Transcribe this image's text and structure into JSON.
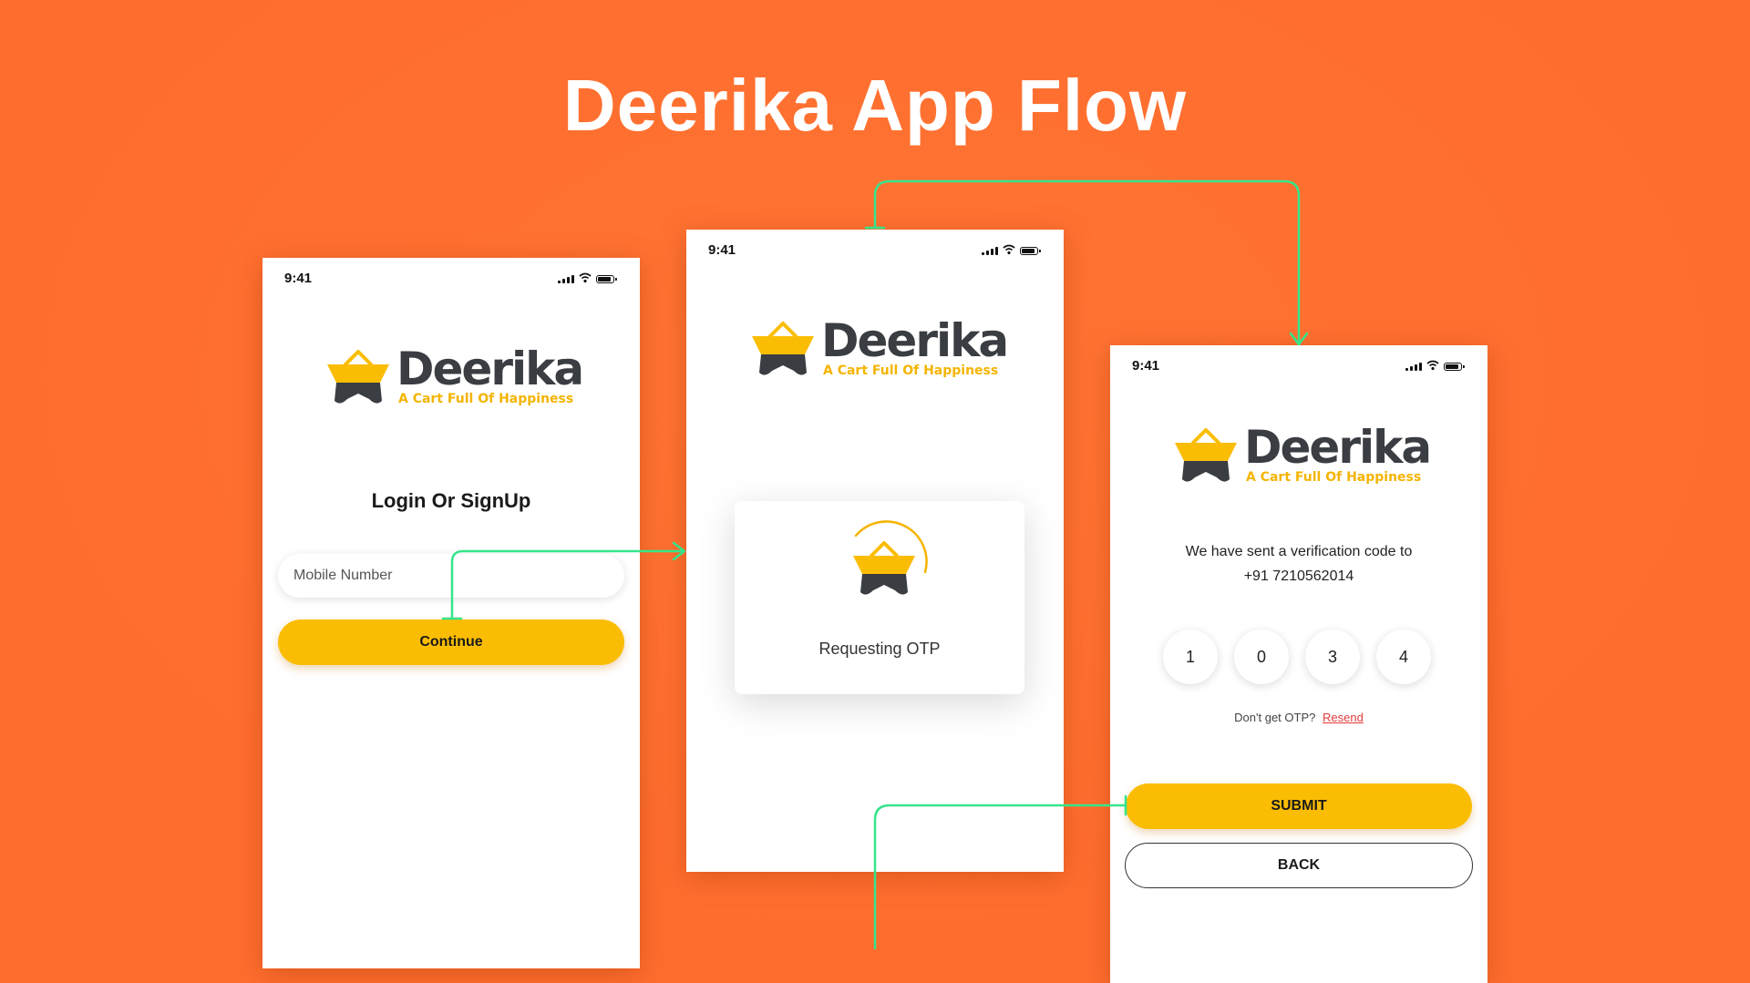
{
  "page": {
    "title": "Deerika App Flow"
  },
  "colors": {
    "background": "#ff6d2e",
    "accent_yellow": "#fbbd03",
    "connector_green": "#35e58a",
    "logo_dark": "#3a3d42"
  },
  "status_bar": {
    "time": "9:41",
    "icons": [
      "cellular-signal-icon",
      "wifi-icon",
      "battery-icon"
    ]
  },
  "brand": {
    "name": "Deerika",
    "tagline": "A Cart Full Of Happiness"
  },
  "login_screen": {
    "heading": "Login Or SignUp",
    "mobile_placeholder": "Mobile Number",
    "continue_label": "Continue"
  },
  "otp_request_screen": {
    "status_text": "Requesting OTP"
  },
  "verify_screen": {
    "message_line1": "We have sent a verification code to",
    "phone_number": "+91 7210562014",
    "otp_digits": [
      "1",
      "0",
      "3",
      "4"
    ],
    "resend_prompt": "Don't get OTP?",
    "resend_label": "Resend",
    "submit_label": "SUBMIT",
    "back_label": "BACK"
  }
}
